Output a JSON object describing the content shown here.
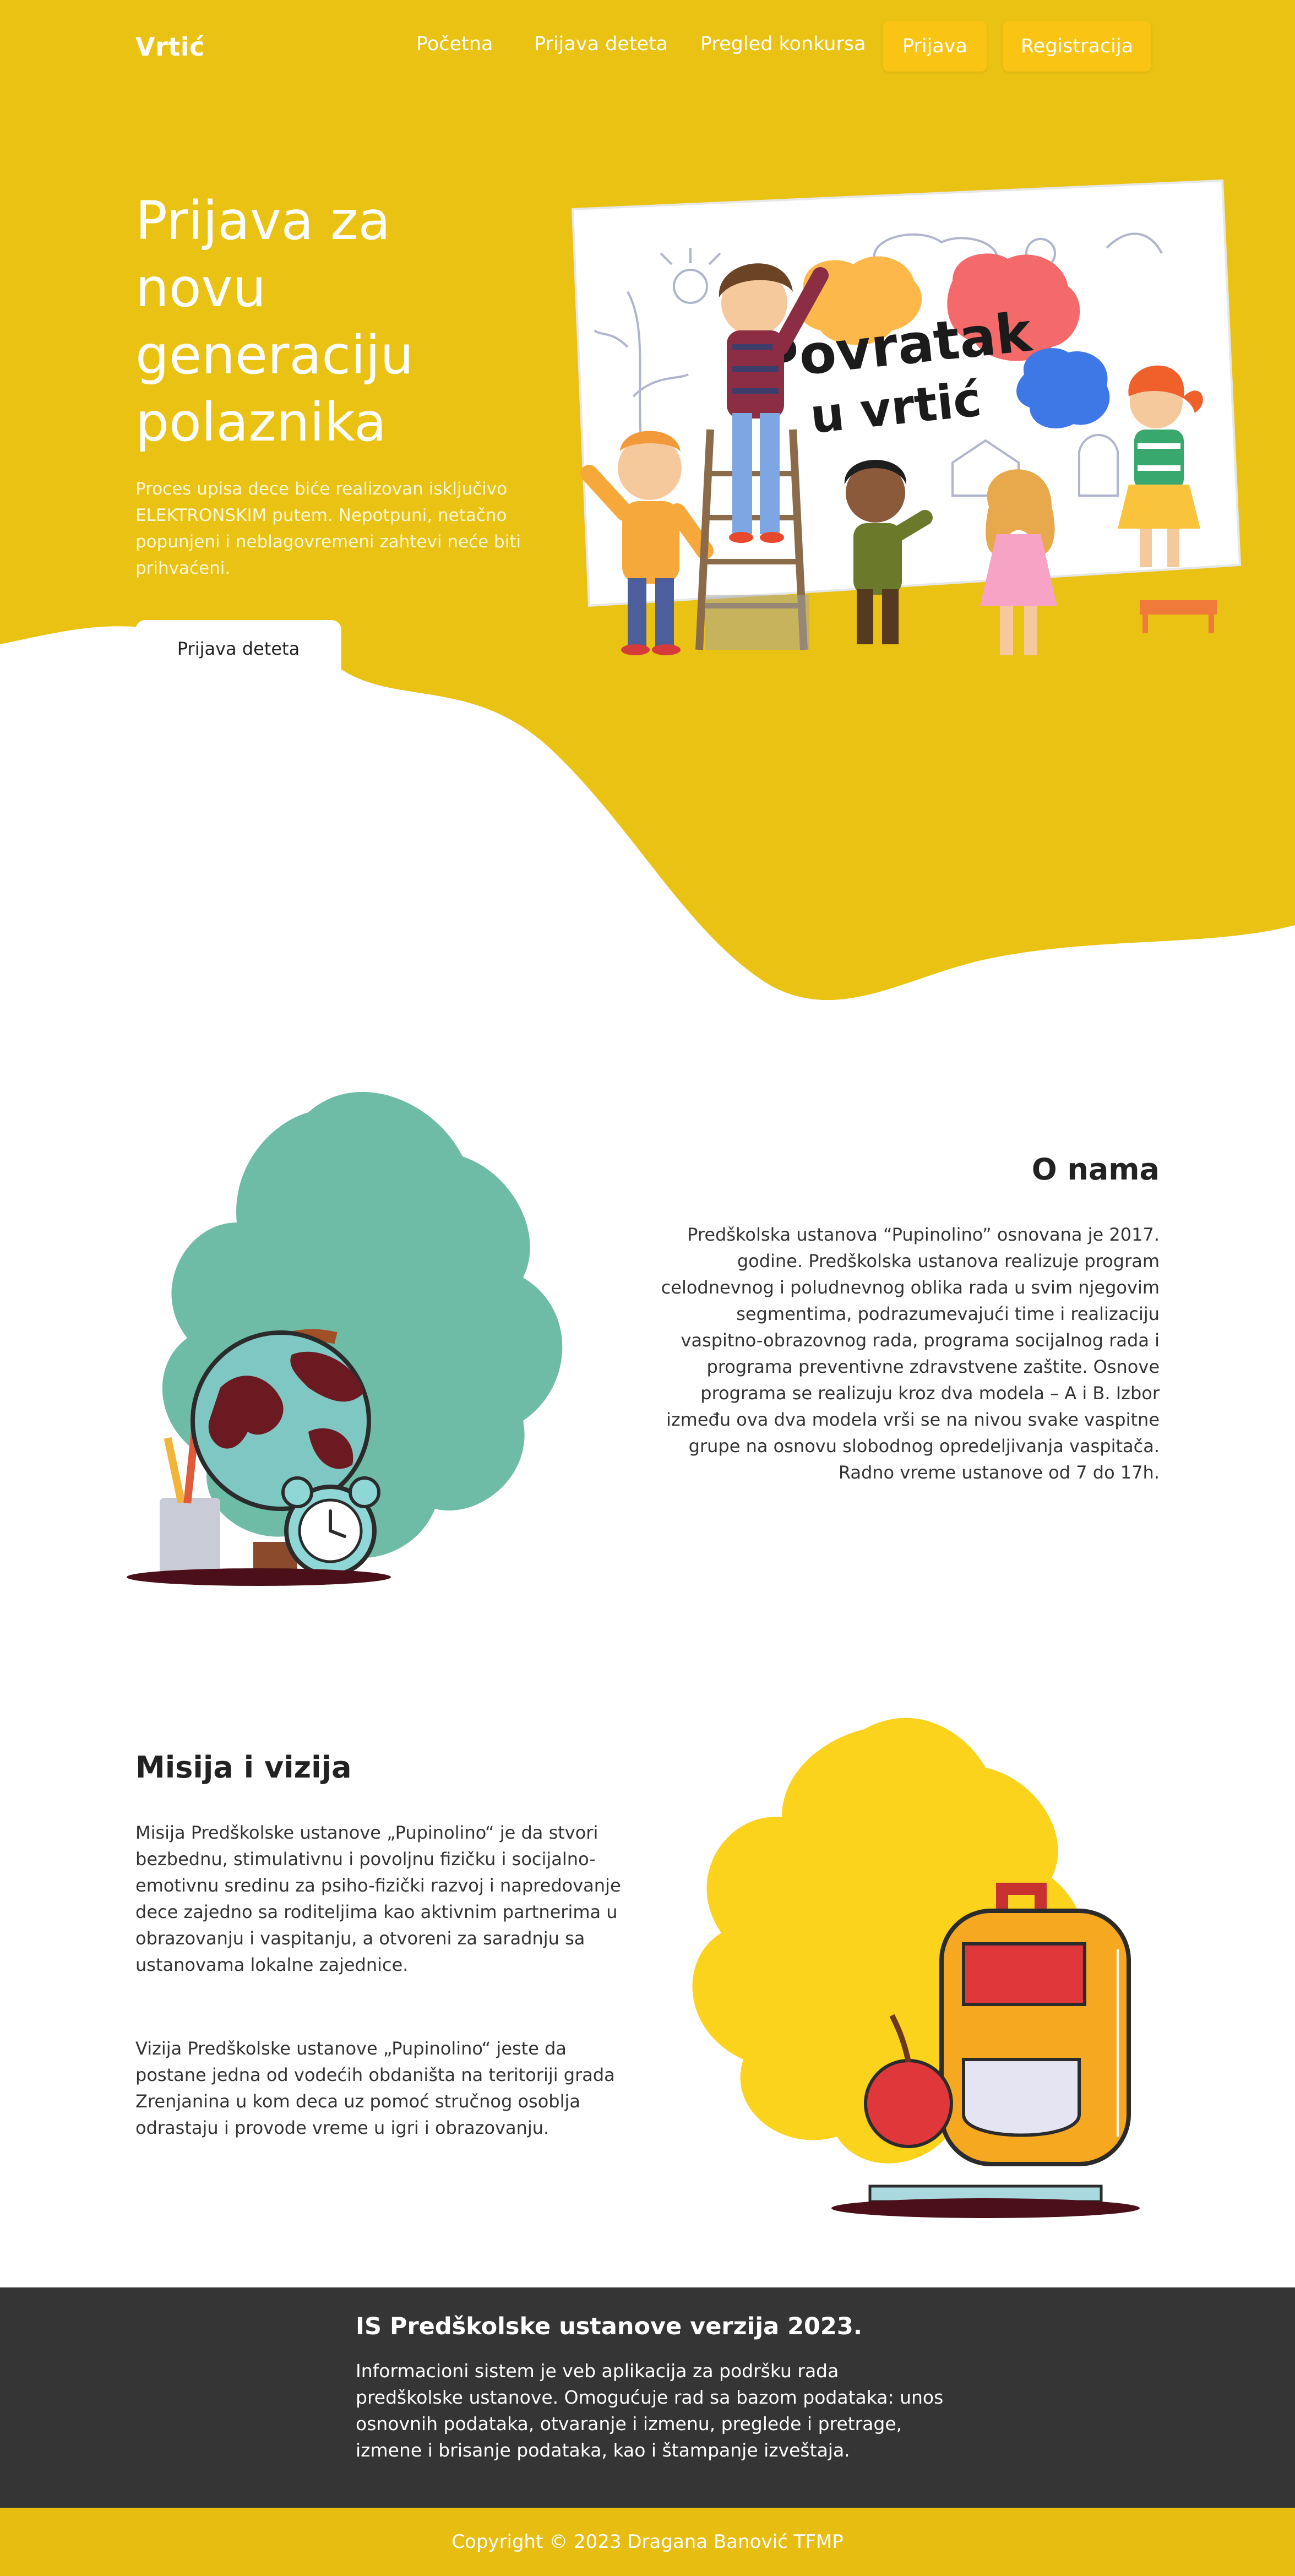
{
  "nav": {
    "brand": "Vrtić",
    "links": [
      "Početna",
      "Prijava deteta",
      "Pregled konkursa"
    ],
    "login": "Prijava",
    "register": "Registracija"
  },
  "hero": {
    "title": "Prijava za novu generaciju polaznika",
    "text": "Proces upisa dece biće realizovan isključivo ELEKTRONSKIM putem. Nepotpuni, netačno popunjeni i neblagovremeni zahtevi neće biti prihvaćeni.",
    "cta": "Prijava deteta",
    "art_caption_line1": "Povratak",
    "art_caption_line2": "u vrtić"
  },
  "about": {
    "title": "O nama",
    "text": "Predškolska ustanova “Pupinolino” osnovana je 2017. godine. Predškolska ustanova realizuje program celodnevnog i poludnevnog oblika rada u svim njegovim segmentima, podrazumevajući time i realizaciju vaspitno-obrazovnog rada, programa socijalnog rada i programa preventivne zdravstvene zaštite. Osnove programa se realizuju kroz dva modela – A i B. Izbor između ova dva modela vrši se na nivou svake vaspitne grupe na osnovu slobodnog opredeljivanja vaspitača. Radno vreme ustanove od 7 do 17h."
  },
  "mission": {
    "title": "Misija i vizija",
    "mission_text": "Misija Predškolske ustanove „Pupinolino“ je da stvori bezbednu, stimulativnu i povoljnu fizičku i socijalno-emotivnu sredinu za psiho-fizički razvoj i napredovanje dece zajedno sa roditeljima kao aktivnim partnerima u obrazovanju i vaspitanju, a otvoreni za saradnju sa ustanovama lokalne zajednice.",
    "vision_text": "Vizija Predškolske ustanove „Pupinolino“ jeste da postane jedna od vodećih obdaništa na teritoriji grada Zrenjanina u kom deca uz pomoć stručnog osoblja odrastaju i provode vreme u igri i obrazovanju."
  },
  "footer": {
    "title": "IS Predškolske ustanove verzija 2023.",
    "text": "Informacioni sistem je veb aplikacija za podršku rada predškolske ustanove. Omogućuje rad sa bazom podataka: unos osnovnih podataka, otvaranje i izmenu, preglede i pretrage, izmene i brisanje podataka, kao i štampanje izveštaja.",
    "copyright": "Copyright © 2023 Dragana Banović TFMP"
  },
  "colors": {
    "hero_yellow": "#e9c213",
    "button_yellow": "#f9c414",
    "footer_dark": "#353535",
    "copyright_yellow": "#e8bd12",
    "teal_blob": "#6fbca6",
    "yellow_blob": "#fbd21c"
  }
}
